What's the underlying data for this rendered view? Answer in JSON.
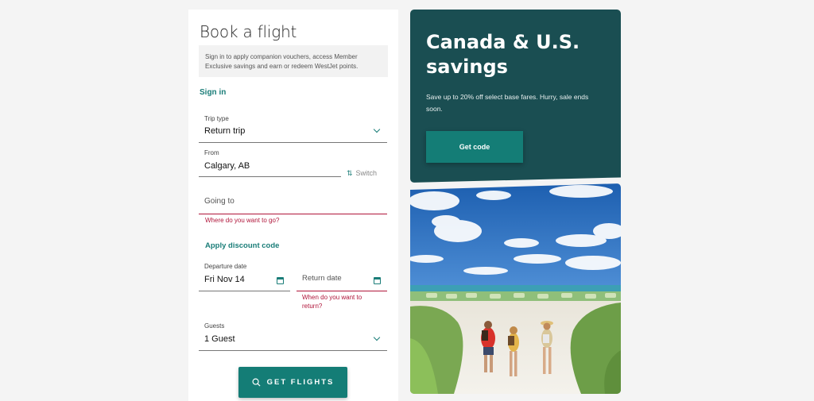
{
  "booking": {
    "title": "Book a flight",
    "note": "Sign in to apply companion vouchers, access Member Exclusive savings and earn or redeem WestJet points.",
    "sign_in": "Sign in",
    "trip_type": {
      "label": "Trip type",
      "value": "Return trip"
    },
    "from": {
      "label": "From",
      "value": "Calgary, AB"
    },
    "switch": "Switch",
    "going_to": {
      "placeholder": "Going to",
      "error": "Where do you want to go?"
    },
    "apply_discount": "Apply discount code",
    "departure": {
      "label": "Departure date",
      "value": "Fri Nov 14"
    },
    "return": {
      "placeholder": "Return date",
      "error": "When do you want to return?"
    },
    "guests": {
      "label": "Guests",
      "value": "1 Guest"
    },
    "get_flights": "GET FLIGHTS"
  },
  "promo": {
    "headline": "Canada & U.S. savings",
    "description": "Save up to 20% off select base fares. Hurry, sale ends soon.",
    "button": "Get code"
  },
  "colors": {
    "accent": "#147d76",
    "promo_bg": "#1a4e52",
    "error": "#b0153a"
  }
}
